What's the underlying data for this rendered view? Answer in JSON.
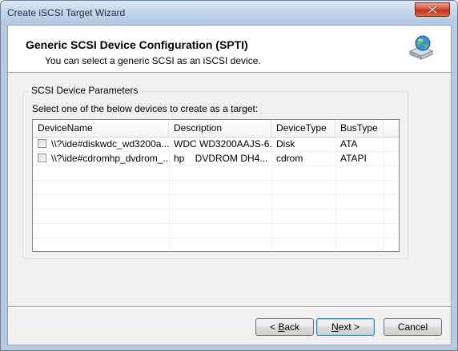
{
  "window": {
    "title": "Create iSCSI Target Wizard"
  },
  "header": {
    "title": "Generic SCSI Device Configuration (SPTI)",
    "subtitle": "You can select a generic SCSI as an iSCSI device.",
    "icon": "network-drive-globe-icon"
  },
  "group": {
    "legend": "SCSI Device Parameters",
    "select_label": "Select one of the below devices to create as a target:"
  },
  "table": {
    "columns": [
      "DeviceName",
      "Description",
      "DeviceType",
      "BusType"
    ],
    "rows": [
      {
        "checked": false,
        "device_name": "\\\\?\\ide#diskwdc_wd3200a...",
        "description": "WDC WD3200AAJS-6...",
        "device_type": "Disk",
        "bus_type": "ATA"
      },
      {
        "checked": false,
        "device_name": "\\\\?\\ide#cdromhp_dvdrom_...",
        "description": "hp    DVDROM DH4...",
        "device_type": "cdrom",
        "bus_type": "ATAPI"
      }
    ]
  },
  "buttons": {
    "back_pre": "< ",
    "back_mn": "B",
    "back_post": "ack",
    "next_mn": "N",
    "next_post": "ext >",
    "cancel": "Cancel"
  },
  "colors": {
    "title_bar": "#c2d5ea",
    "close_button": "#c2301a",
    "header_bg": "#ffffff",
    "dialog_bg": "#f0f0f0",
    "default_button_border": "#3c7fb1"
  }
}
